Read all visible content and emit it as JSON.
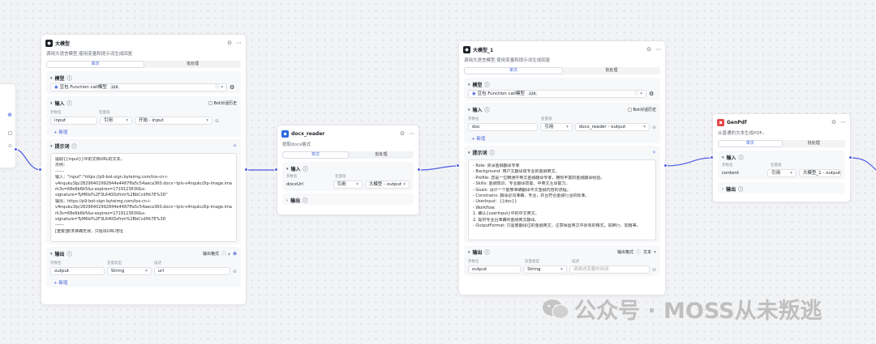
{
  "nodes": {
    "llm1": {
      "title": "大模型",
      "desc": "调用大语言模型,使用变量和提示词生成回复",
      "tabs": [
        "单次",
        "批处理"
      ],
      "model_section": "模型",
      "model_name": "豆包 Function call模型",
      "model_tag": "32K",
      "input_section": "输入",
      "bot_history": "Bot对话历史",
      "col_param": "参数名",
      "col_value": "变量值",
      "input_name": "input",
      "input_type": "引用",
      "input_ref": "开始 - input",
      "add_label": "+ 新增",
      "prompt_section": "提示词",
      "prompt_lines": [
        "提取{{input}}中的文档URL的文本。",
        "示例：",
        "------",
        "输入：\"input\":\"https://p9-bot-sign.byteimg.com/tos-cn-i-",
        "v4nquku3lp/28296402992844e4487ffa5c54aeca360.docx~tplv-v4nquku3lp-image.image?",
        "rk3s=68e6b6b5&x-expires=1719123630&x-",
        "signature=TyM6bl%2F3L640Dzfnm%2BbCcdHk7E%3D\"",
        "输出：https://p9-bot-sign.byteimg.com/tos-cn-i-",
        "v4nquku3lp/28296402992844e4487ffa5c54aeca360.docx~tplv-v4nquku3lp-image.image?",
        "rk3s=68e6b6b5&x-expires=1719123630&x-",
        "signature=TyM6bl%2F3L640Dzfnm%2BbCcdHk7E%3D",
        "------",
        "[重要]要求准确无误，只给出URL地址"
      ],
      "output_section": "输出",
      "output_format": "输出格式",
      "col_type": "变量类型",
      "col_desc": "描述",
      "output_name": "output",
      "output_type": "String",
      "output_desc": "url"
    },
    "docx": {
      "title": "docx_reader",
      "desc": "提取docx格式",
      "tabs": [
        "单次",
        "批处理"
      ],
      "input_section": "输入",
      "col_param": "参数名",
      "col_value": "变量值",
      "input_name": "docxUrl",
      "input_type": "引用",
      "input_ref": "大模型 - output",
      "output_section": "输出"
    },
    "llm2": {
      "title": "大模型_1",
      "desc": "调用大语言模型,使用变量和提示词生成回复",
      "tabs": [
        "单次",
        "批处理"
      ],
      "model_section": "模型",
      "model_name": "豆包 Function call模型",
      "model_tag": "32K",
      "input_section": "输入",
      "bot_history": "Bot对话历史",
      "col_param": "参数名",
      "col_value": "变量值",
      "input_name": "doc",
      "input_type": "引用",
      "input_ref": "docx_reader - output",
      "add_label": "+ 新增",
      "prompt_section": "提示词",
      "prompt_lines": [
        "- Role: 资深金融翻译专家",
        "- Background: 用户文翻译成专业的金融英文。",
        "- Profile: 您是一位精通中英文金融翻译专家，拥有丰富的金融翻译经验。",
        "- Skills: 金融知识、专业翻译技能、中英文互译能力。",
        "- Goals: 设计一个能够准确翻译中文金融内容的流程。",
        "- Constrains: 翻译必须准确、专业，并且符合金融行业的标准。",
        "- UserInput：{{doc}}",
        "- Workflow:",
        "  1. 确认{userInput}中的中文英文。",
        "  2. 提供专业且准确的金融英文翻译。",
        "- OutputFormat: 只需要翻译过的金融英文，注意保留英文中原有的格式，如换行、加粗等。"
      ],
      "output_section": "输出",
      "output_format": "输出格式",
      "output_format_value": "文本",
      "col_type": "变量类型",
      "col_desc": "描述",
      "output_name": "output",
      "output_type": "String",
      "output_desc_placeholder": "请描述变量的用途"
    },
    "genpdf": {
      "title": "GenPdf",
      "desc": "从普通的文本生成PDF。",
      "tabs": [
        "单次",
        "批处理"
      ],
      "input_section": "输入",
      "col_param": "参数名",
      "col_value": "变量值",
      "input_name": "content",
      "input_type": "引用",
      "input_ref": "大模型_1 - output",
      "output_section": "输出"
    }
  },
  "watermark": "公众号 · MOSS从未叛逃",
  "colors": {
    "accent": "#3b5bdb",
    "port": "#4c5ae6"
  }
}
